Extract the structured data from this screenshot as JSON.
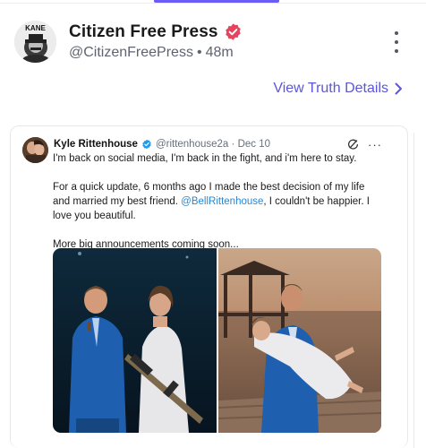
{
  "post": {
    "account_name": "Citizen Free Press",
    "handle": "@CitizenFreePress",
    "separator": "•",
    "time": "48m",
    "avatar_text": "KANE",
    "view_details_label": "View Truth Details"
  },
  "embedded_tweet": {
    "author": "Kyle Rittenhouse",
    "handle": "@rittenhouse2a",
    "separator": "·",
    "date": "Dec 10",
    "more_label": "···",
    "line1": "I'm back on social media, I'm back in the fight, and i'm here to stay.",
    "line2_before": "For a quick update, 6 months ago I made the best decision of my life and married my best friend. ",
    "mention": "@BellRittenhouse",
    "line2_after": ", I couldn't be happier. I love you beautiful.",
    "line3": "More big announcements coming soon..."
  },
  "colors": {
    "accent": "#6b5cf5",
    "verified": "#e8425c",
    "link": "#5b57d6",
    "mention": "#2a87d4"
  },
  "icons": {
    "verified": "verified-badge-icon",
    "menu": "kebab-menu-icon",
    "chevron": "chevron-right-icon",
    "grok": "grok-icon"
  }
}
